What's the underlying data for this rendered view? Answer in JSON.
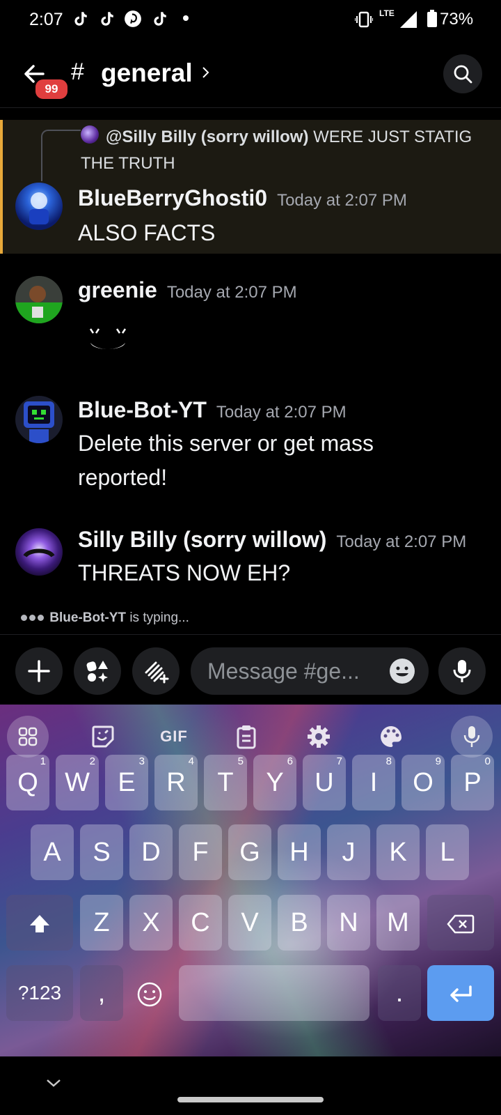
{
  "status_bar": {
    "time": "2:07",
    "app_icons": [
      "tiktok-icon",
      "tiktok-icon",
      "pinterest-icon",
      "tiktok-icon"
    ],
    "network": "LTE",
    "battery": "73%"
  },
  "header": {
    "unread_badge": "99",
    "hash": "#",
    "channel_name": "general"
  },
  "messages": [
    {
      "reply_to": {
        "mention": "@Silly Billy (sorry willow)",
        "text": "WERE JUST STATIG THE TRUTH"
      },
      "author": "BlueBerryGhosti0",
      "timestamp": "Today at 2:07 PM",
      "text": "ALSO FACTS",
      "highlighted": true
    },
    {
      "author": "greenie",
      "timestamp": "Today at 2:07 PM",
      "text": ""
    },
    {
      "author": "Blue-Bot-YT",
      "timestamp": "Today at 2:07 PM",
      "text": "Delete this server or get mass reported!"
    },
    {
      "author": "Silly Billy (sorry willow)",
      "timestamp": "Today at 2:07 PM",
      "text": "THREATS NOW EH?"
    }
  ],
  "typing": {
    "user": "Blue-Bot-YT",
    "suffix": "is typing..."
  },
  "composer": {
    "placeholder": "Message #ge..."
  },
  "keyboard": {
    "toolbar_gif": "GIF",
    "row1": [
      {
        "key": "Q",
        "hint": "1"
      },
      {
        "key": "W",
        "hint": "2"
      },
      {
        "key": "E",
        "hint": "3"
      },
      {
        "key": "R",
        "hint": "4"
      },
      {
        "key": "T",
        "hint": "5"
      },
      {
        "key": "Y",
        "hint": "6"
      },
      {
        "key": "U",
        "hint": "7"
      },
      {
        "key": "I",
        "hint": "8"
      },
      {
        "key": "O",
        "hint": "9"
      },
      {
        "key": "P",
        "hint": "0"
      }
    ],
    "row2": [
      "A",
      "S",
      "D",
      "F",
      "G",
      "H",
      "J",
      "K",
      "L"
    ],
    "row3": [
      "Z",
      "X",
      "C",
      "V",
      "B",
      "N",
      "M"
    ],
    "symbols_key": "?123",
    "comma_key": ",",
    "period_key": "."
  },
  "colors": {
    "highlight_bar": "#e8a93a",
    "badge": "#e03e3e",
    "enter_key": "#5c9cf0"
  }
}
